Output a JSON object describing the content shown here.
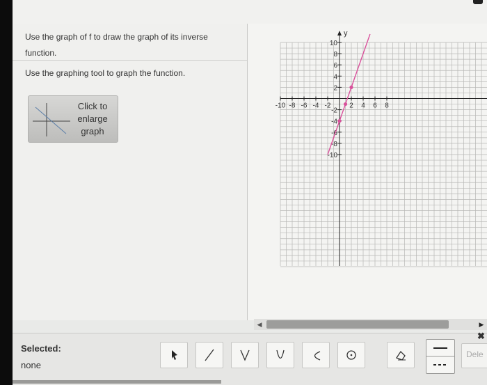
{
  "instructions": {
    "line1": "Use the graph of f to draw the graph of its inverse",
    "line1b": "function.",
    "line2": "Use the graphing tool to graph the function.",
    "enlarge_button": "Click to enlarge graph"
  },
  "graph": {
    "axis_label": "y",
    "x_ticks": [
      "-10",
      "-8",
      "-6",
      "-4",
      "-2",
      "2",
      "4",
      "6",
      "8"
    ],
    "y_ticks": [
      "10",
      "8",
      "6",
      "4",
      "2",
      "-2",
      "-4",
      "-6",
      "-8",
      "-10"
    ]
  },
  "chart_data": {
    "type": "line",
    "xlim": [
      -10,
      10
    ],
    "ylim": [
      -10,
      10
    ],
    "grid": true,
    "series": [
      {
        "x": [
          -1,
          0,
          1,
          2,
          3
        ],
        "y": [
          -7,
          -4,
          -1,
          2,
          5
        ],
        "points": [
          [
            0,
            -4
          ],
          [
            1,
            -1
          ],
          [
            2,
            2
          ]
        ],
        "color": "#d9509b"
      }
    ]
  },
  "toolbar": {
    "selected_label": "Selected:",
    "selected_value": "none",
    "delete_label": "Dele",
    "tools": [
      "pointer-icon",
      "line-icon",
      "absolute-value-icon",
      "parabola-icon",
      "sideways-parabola-icon",
      "circle-icon",
      "eraser-icon",
      "dashed-line-icon"
    ]
  },
  "colors": {
    "graph_line": "#d9509b",
    "grid": "#b7b7b5"
  }
}
